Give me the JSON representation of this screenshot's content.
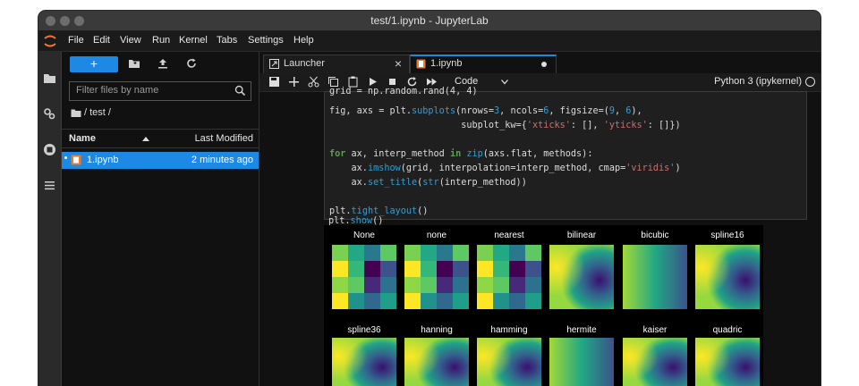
{
  "window": {
    "title": "test/1.ipynb - JupyterLab"
  },
  "menu": [
    "File",
    "Edit",
    "View",
    "Run",
    "Kernel",
    "Tabs",
    "Settings",
    "Help"
  ],
  "activity_icons": [
    "folder-icon",
    "running-icon",
    "stop-icon",
    "list-icon"
  ],
  "filebrowser": {
    "new_label": "+",
    "filter_placeholder": "Filter files by name",
    "breadcrumb": "/ test /",
    "col_name": "Name",
    "col_modified": "Last Modified",
    "files": [
      {
        "name": "1.ipynb",
        "modified": "2 minutes ago"
      }
    ]
  },
  "tabs": [
    {
      "label": "Launcher"
    },
    {
      "label": "1.ipynb"
    }
  ],
  "toolbar": {
    "cell_type": "Code",
    "kernel": "Python 3 (ipykernel)"
  },
  "code_lines": [
    "grid = np.random.rand(4, 4)",
    "",
    "fig, axs = plt.subplots(nrows=3, ncols=6, figsize=(9, 6),",
    "                        subplot_kw={'xticks': [], 'yticks': []})",
    "",
    "for ax, interp_method in zip(axs.flat, methods):",
    "    ax.imshow(grid, interpolation=interp_method, cmap='viridis')",
    "    ax.set_title(str(interp_method))",
    "",
    "plt.tight_layout()",
    "plt.show()"
  ],
  "plot_titles": [
    "None",
    "none",
    "nearest",
    "bilinear",
    "bicubic",
    "spline16",
    "spline36",
    "hanning",
    "hamming",
    "hermite",
    "kaiser",
    "quadric"
  ],
  "colors": {
    "accent": "#1e88e5",
    "background": "#111111"
  }
}
